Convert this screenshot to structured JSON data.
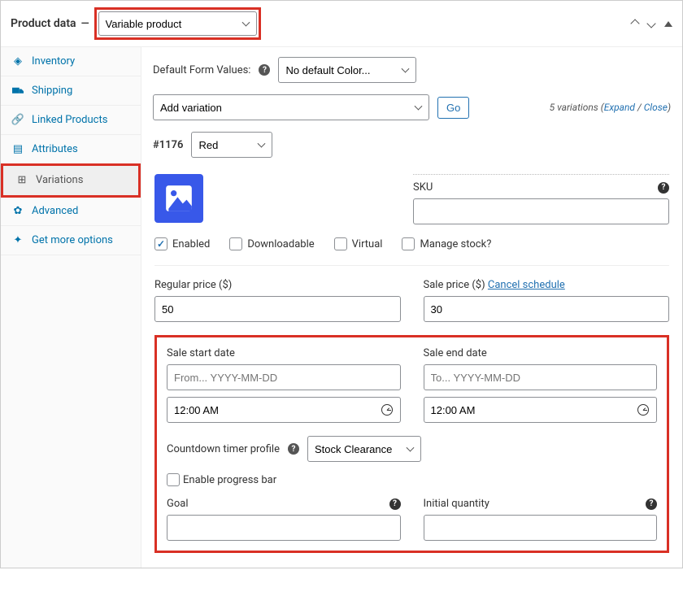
{
  "header": {
    "title": "Product data",
    "product_type": "Variable product"
  },
  "tabs": {
    "inventory": "Inventory",
    "shipping": "Shipping",
    "linked_products": "Linked Products",
    "attributes": "Attributes",
    "variations": "Variations",
    "advanced": "Advanced",
    "get_more": "Get more options"
  },
  "defaults": {
    "label": "Default Form Values:",
    "value": "No default Color..."
  },
  "add_variation": {
    "value": "Add variation",
    "go": "Go",
    "count_text": "5 variations",
    "expand": "Expand",
    "close": "Close"
  },
  "variation": {
    "id": "#1176",
    "attr_value": "Red",
    "sku_label": "SKU",
    "sku_value": "",
    "enabled": "Enabled",
    "downloadable": "Downloadable",
    "virtual": "Virtual",
    "manage_stock": "Manage stock?",
    "regular_price_label": "Regular price ($)",
    "regular_price_value": "50",
    "sale_price_label": "Sale price ($)",
    "cancel_schedule": "Cancel schedule",
    "sale_price_value": "30"
  },
  "schedule": {
    "start_label": "Sale start date",
    "start_placeholder": "From... YYYY-MM-DD",
    "start_time": "12:00 AM",
    "end_label": "Sale end date",
    "end_placeholder": "To... YYYY-MM-DD",
    "end_time": "12:00 AM",
    "timer_profile_label": "Countdown timer profile",
    "timer_profile_value": "Stock Clearance",
    "progress_bar": "Enable progress bar",
    "goal_label": "Goal",
    "goal_value": "",
    "initial_qty_label": "Initial quantity",
    "initial_qty_value": ""
  }
}
